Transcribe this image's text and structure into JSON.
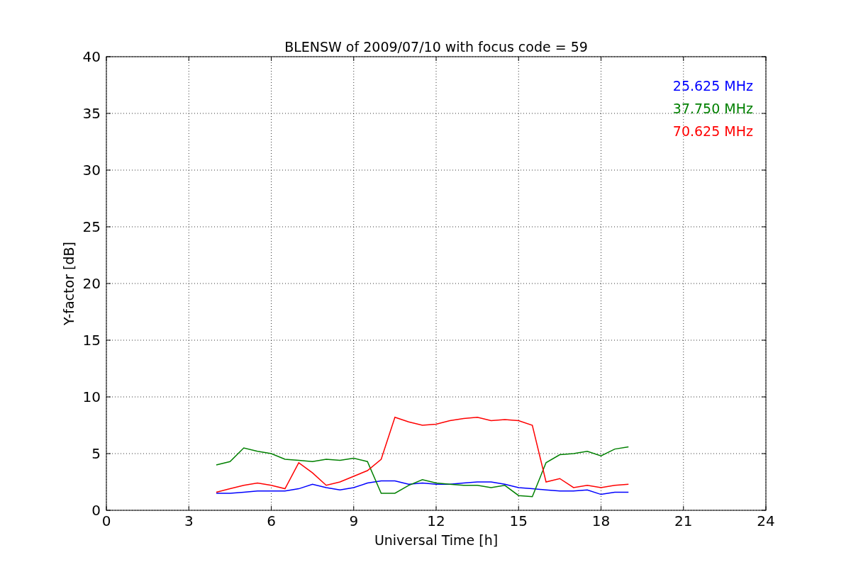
{
  "chart": {
    "chart_data": {
      "type": "line",
      "title": "BLENSW of 2009/07/10 with focus code = 59",
      "xlabel": "Universal Time [h]",
      "ylabel": "Y-factor [dB]",
      "x": [
        4,
        4.5,
        5,
        5.5,
        6,
        6.5,
        7,
        7.5,
        8,
        8.5,
        9,
        9.5,
        10,
        10.5,
        11,
        11.5,
        12,
        12.5,
        13,
        13.5,
        14,
        14.5,
        15,
        15.5,
        16,
        16.5,
        17,
        17.5,
        18,
        18.5,
        19
      ],
      "series": [
        {
          "name": "25.625 MHz",
          "color": "#0000ff",
          "values": [
            1.5,
            1.5,
            1.6,
            1.7,
            1.7,
            1.7,
            1.9,
            2.3,
            2.0,
            1.8,
            2.0,
            2.4,
            2.6,
            2.6,
            2.3,
            2.4,
            2.3,
            2.3,
            2.4,
            2.5,
            2.5,
            2.3,
            2.0,
            1.9,
            1.8,
            1.7,
            1.7,
            1.8,
            1.4,
            1.6,
            1.6
          ]
        },
        {
          "name": "37.750 MHz",
          "color": "#008000",
          "values": [
            4.0,
            4.3,
            5.5,
            5.2,
            5.0,
            4.5,
            4.4,
            4.3,
            4.5,
            4.4,
            4.6,
            4.3,
            1.5,
            1.5,
            2.2,
            2.7,
            2.4,
            2.3,
            2.2,
            2.2,
            2.0,
            2.2,
            1.3,
            1.2,
            4.2,
            4.9,
            5.0,
            5.2,
            4.8,
            5.4,
            5.6
          ]
        },
        {
          "name": "70.625 MHz",
          "color": "#ff0000",
          "values": [
            1.6,
            1.9,
            2.2,
            2.4,
            2.2,
            1.9,
            4.2,
            3.3,
            2.2,
            2.5,
            3.0,
            3.5,
            4.5,
            8.2,
            7.8,
            7.5,
            7.6,
            7.9,
            8.1,
            8.2,
            7.9,
            8.0,
            7.9,
            7.5,
            2.5,
            2.8,
            2.0,
            2.2,
            2.0,
            2.2,
            2.3
          ]
        }
      ],
      "xlim": [
        0,
        24
      ],
      "ylim": [
        0,
        40
      ],
      "xticks": [
        0,
        3,
        6,
        9,
        12,
        15,
        18,
        21,
        24
      ],
      "yticks": [
        0,
        5,
        10,
        15,
        20,
        25,
        30,
        35,
        40
      ],
      "grid": true
    }
  }
}
